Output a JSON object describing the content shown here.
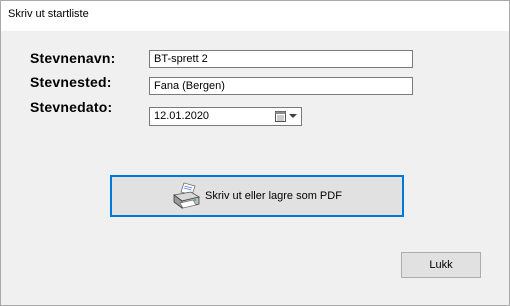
{
  "window": {
    "title": "Skriv ut startliste"
  },
  "form": {
    "name_label": "Stevnenavn:",
    "name_value": "BT-sprett 2",
    "place_label": "Stevnested:",
    "place_value": "Fana (Bergen)",
    "date_label": "Stevnedato:",
    "date_value": "12.01.2020",
    "date_picker_icon": "calendar-icon"
  },
  "actions": {
    "print_label": "Skriv ut eller lagre som PDF",
    "print_icon": "printer-icon",
    "close_label": "Lukk"
  },
  "colors": {
    "background": "#f0f0f0",
    "titlebar": "#ffffff",
    "focus_border": "#0078d7",
    "button_face": "#e1e1e1"
  }
}
